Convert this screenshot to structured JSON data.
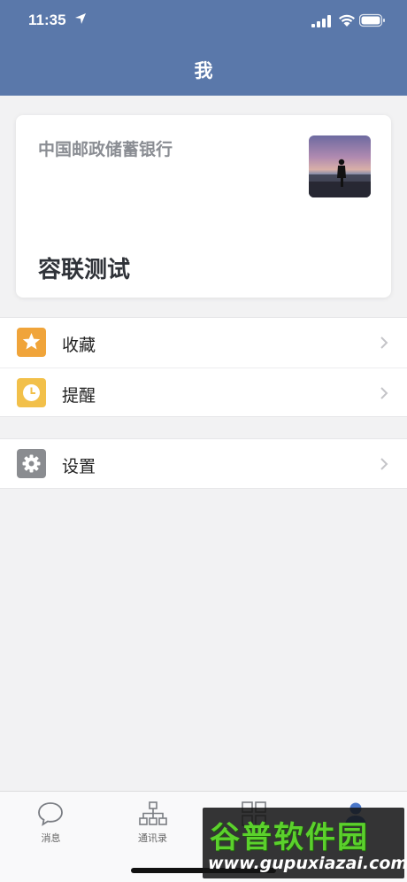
{
  "status_bar": {
    "time": "11:35"
  },
  "header": {
    "title": "我"
  },
  "card": {
    "organization": "中国邮政储蓄银行",
    "name": "容联测试"
  },
  "menu_group_1": [
    {
      "label": "收藏",
      "icon": "star-icon",
      "color": "#f0a43a"
    },
    {
      "label": "提醒",
      "icon": "clock-icon",
      "color": "#f2c04a"
    }
  ],
  "menu_group_2": [
    {
      "label": "设置",
      "icon": "gear-icon",
      "color": "#8a8c90"
    }
  ],
  "tabbar": {
    "tabs": [
      {
        "label": "消息",
        "icon": "chat-bubble-icon"
      },
      {
        "label": "通讯录",
        "icon": "org-chart-icon"
      },
      {
        "label": "",
        "icon": "grid-icon"
      },
      {
        "label": "",
        "icon": "person-icon"
      }
    ]
  },
  "watermark": {
    "title": "谷普软件园",
    "url": "www.gupuxiazai.com"
  },
  "colors": {
    "header": "#5a78aa",
    "background": "#f2f2f3",
    "accent": "#4a77c9"
  }
}
